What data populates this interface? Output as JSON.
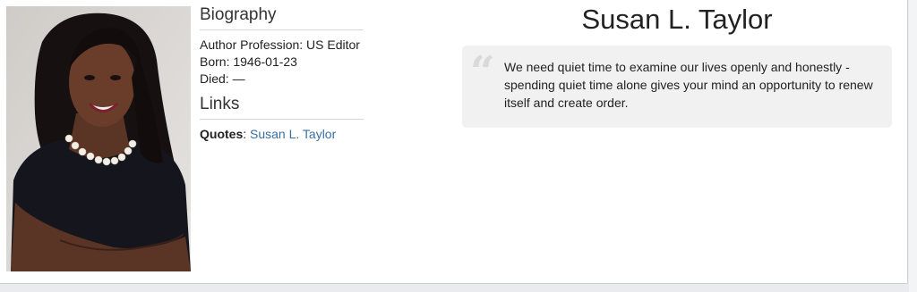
{
  "profile": {
    "photo_alt": "Susan L. Taylor portrait",
    "name": "Susan L. Taylor"
  },
  "biography": {
    "title": "Biography",
    "profession": "Author Profession: US Editor",
    "born": "Born: 1946-01-23",
    "died": "Died: —"
  },
  "links": {
    "title": "Links",
    "quotes_label": "Quotes",
    "quotes_separator": ": ",
    "quotes_link": "Susan L. Taylor"
  },
  "quote": {
    "icon": "quote-icon",
    "text": "We need quiet time to examine our lives openly and honestly - spending quiet time alone gives your mind an opportunity to renew itself and create order."
  },
  "colors": {
    "link": "#3a6fa8",
    "quote_bg": "#f1f1f1",
    "page_bg": "#e9ebee"
  }
}
